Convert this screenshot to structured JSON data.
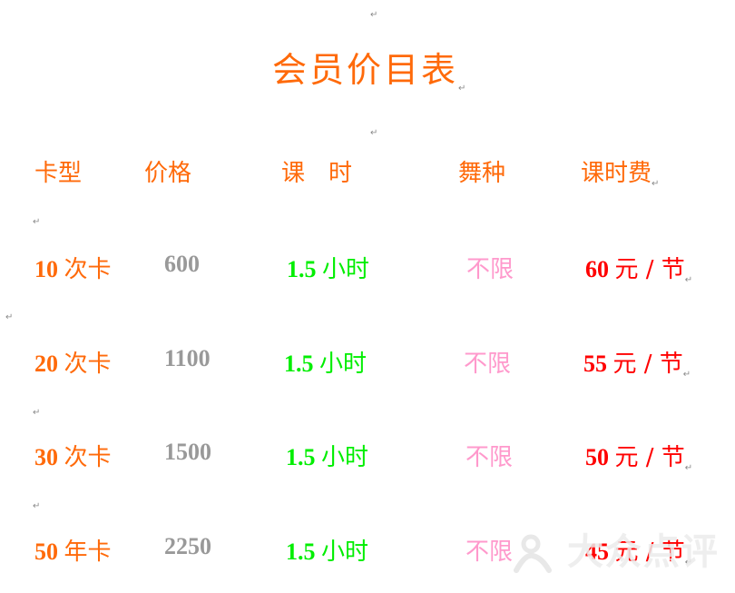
{
  "document": {
    "title": "会员价目表",
    "paragraph_mark": "↵",
    "headers": {
      "card_type": "卡型",
      "price": "价格",
      "duration": "课　时",
      "dance_style": "舞种",
      "fee_per_lesson": "课时费"
    },
    "rows": [
      {
        "card_num": "10",
        "card_unit": "次卡",
        "price": "600",
        "duration_num": "1.5",
        "duration_unit": "小时",
        "dance_style": "不限",
        "fee_num": "60",
        "fee_unit": "元 / 节"
      },
      {
        "card_num": "20",
        "card_unit": "次卡",
        "price": "1100",
        "duration_num": "1.5",
        "duration_unit": "小时",
        "dance_style": "不限",
        "fee_num": "55",
        "fee_unit": "元 / 节"
      },
      {
        "card_num": "30",
        "card_unit": "次卡",
        "price": "1500",
        "duration_num": "1.5",
        "duration_unit": "小时",
        "dance_style": "不限",
        "fee_num": "50",
        "fee_unit": "元 / 节"
      },
      {
        "card_num": "50",
        "card_unit": "年卡",
        "price": "2250",
        "duration_num": "1.5",
        "duration_unit": "小时",
        "dance_style": "不限",
        "fee_num": "45",
        "fee_unit": "元 / 节"
      }
    ],
    "colors": {
      "title": "#ff6a0a",
      "card_type": "#ff6a0a",
      "price": "#999999",
      "duration": "#00ee00",
      "dance_style": "#ff99cc",
      "fee": "#ff0000"
    }
  },
  "watermark": {
    "text": "大众点评",
    "icon": "dianping-person-icon"
  }
}
